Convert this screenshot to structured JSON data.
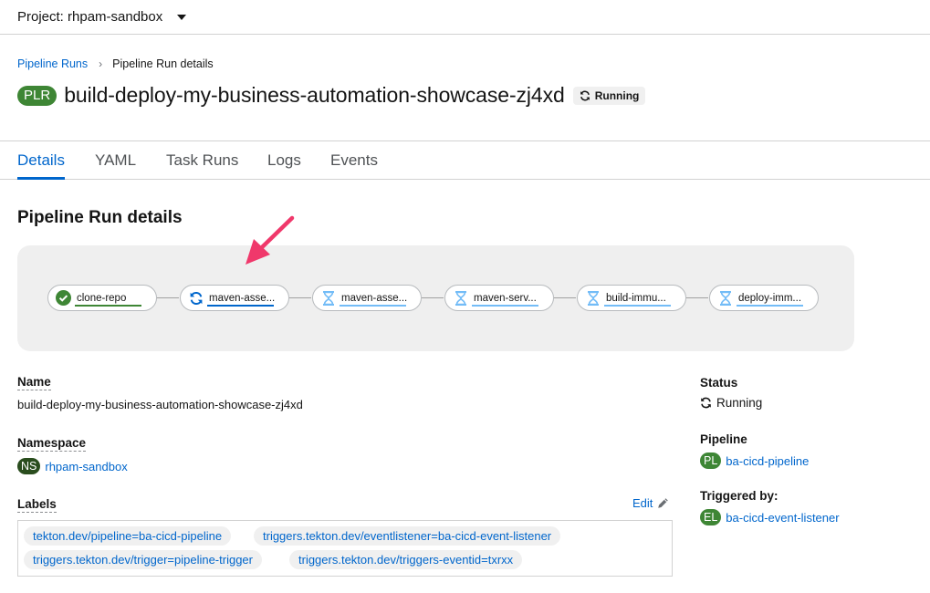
{
  "project": {
    "label": "Project: rhpam-sandbox"
  },
  "breadcrumb": {
    "parent": "Pipeline Runs",
    "current": "Pipeline Run details"
  },
  "header": {
    "badge": "PLR",
    "title": "build-deploy-my-business-automation-showcase-zj4xd",
    "status": "Running"
  },
  "tabs": [
    "Details",
    "YAML",
    "Task Runs",
    "Logs",
    "Events"
  ],
  "section_title": "Pipeline Run details",
  "pipeline": {
    "tasks": [
      {
        "label": "clone-repo",
        "state": "succeeded"
      },
      {
        "label": "maven-asse...",
        "state": "running"
      },
      {
        "label": "maven-asse...",
        "state": "pending"
      },
      {
        "label": "maven-serv...",
        "state": "pending"
      },
      {
        "label": "build-immu...",
        "state": "pending"
      },
      {
        "label": "deploy-imm...",
        "state": "pending"
      }
    ]
  },
  "details": {
    "name_label": "Name",
    "name_value": "build-deploy-my-business-automation-showcase-zj4xd",
    "namespace_label": "Namespace",
    "namespace_badge": "NS",
    "namespace_value": "rhpam-sandbox",
    "labels_label": "Labels",
    "edit_label": "Edit",
    "labels": [
      "tekton.dev/pipeline=ba-cicd-pipeline",
      "triggers.tekton.dev/eventlistener=ba-cicd-event-listener",
      "triggers.tekton.dev/trigger=pipeline-trigger",
      "triggers.tekton.dev/triggers-eventid=txrxx"
    ],
    "status_label": "Status",
    "status_value": "Running",
    "pipeline_label": "Pipeline",
    "pipeline_badge": "PL",
    "pipeline_value": "ba-cicd-pipeline",
    "triggered_label": "Triggered by:",
    "triggered_badge": "EL",
    "triggered_value": "ba-cicd-event-listener"
  },
  "colors": {
    "accent": "#0066cc",
    "success": "#3e8635",
    "running": "#0066cc",
    "pending": "#73bcf7",
    "annotation_arrow": "#f0386b"
  }
}
